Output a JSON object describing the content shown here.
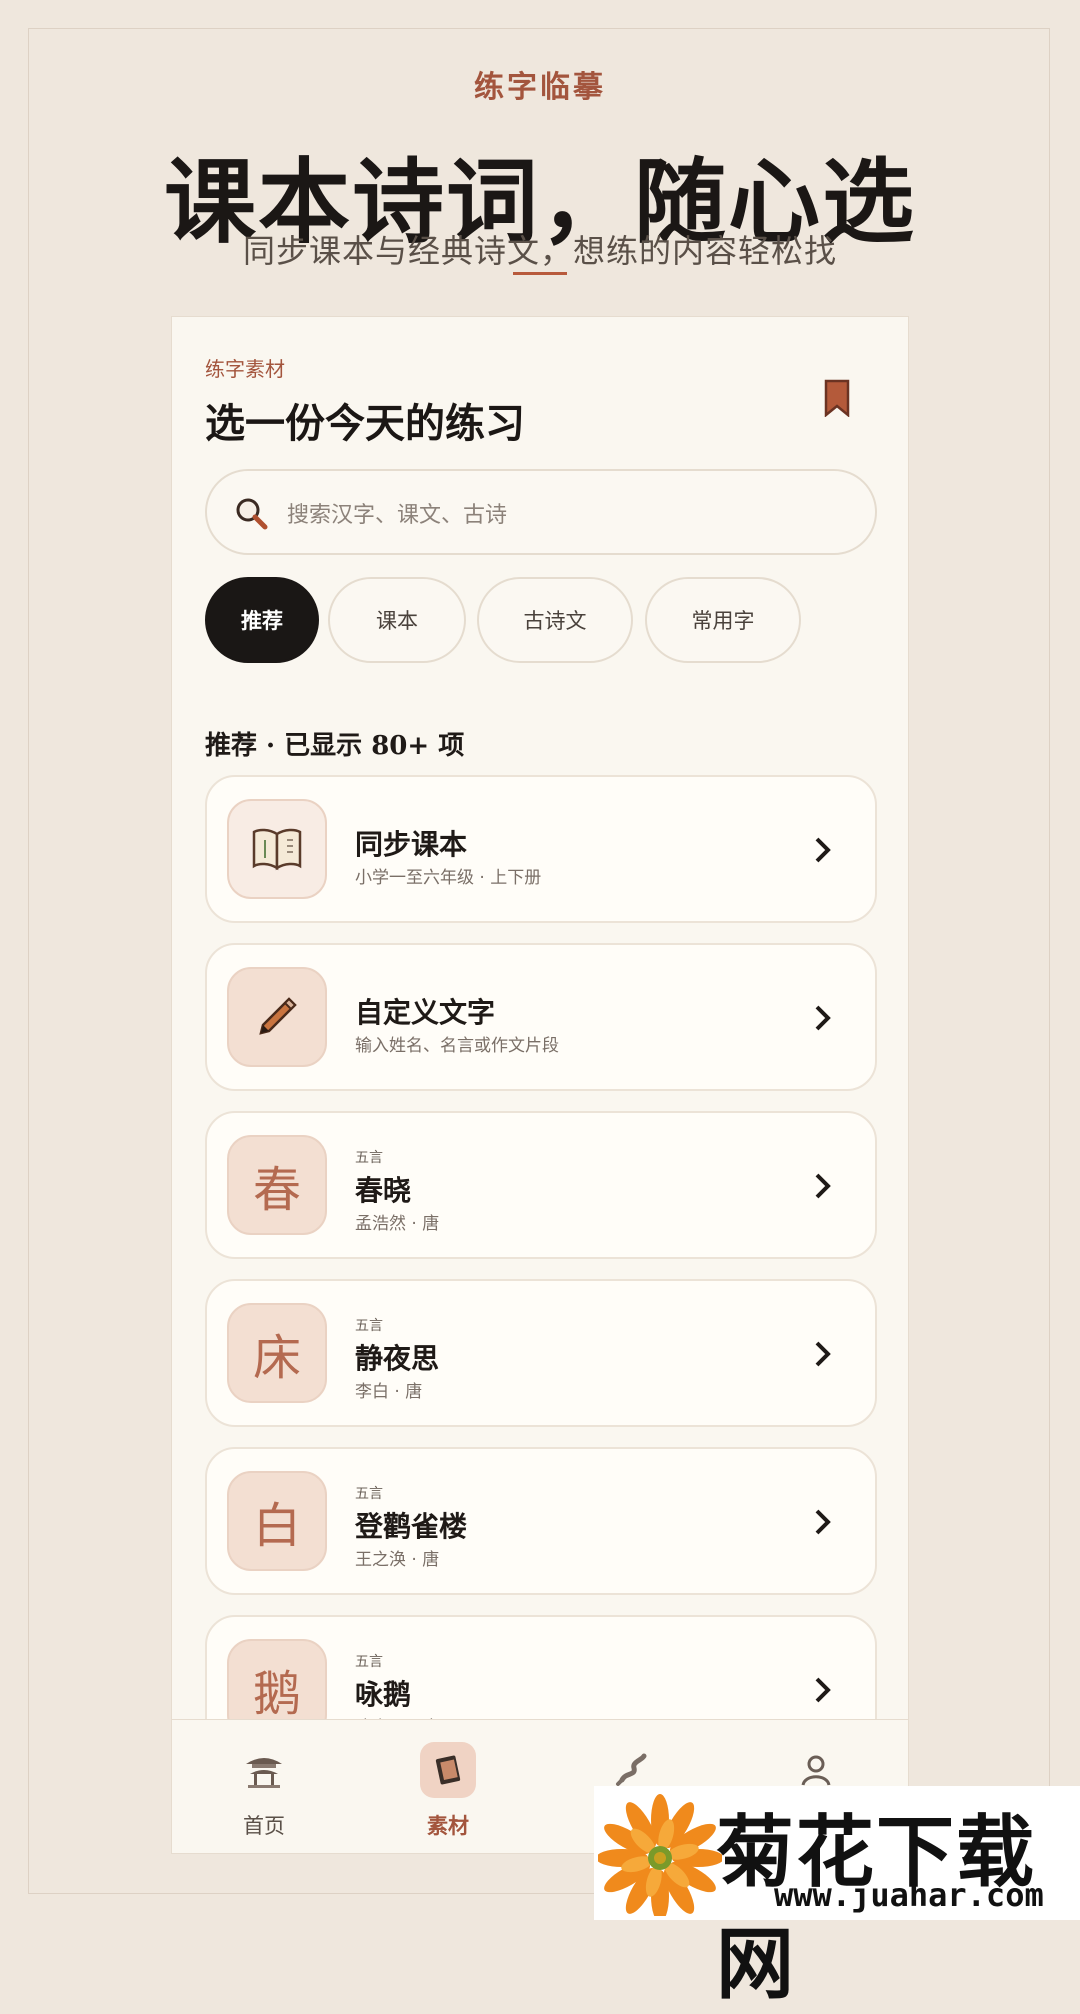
{
  "header": {
    "brand": "练字临摹",
    "headline": "课本诗词，随心选",
    "subline": "同步课本与经典诗文，想练的内容轻松找"
  },
  "screen": {
    "overline": "练字素材",
    "title": "选一份今天的练习",
    "bookmark_icon": "bookmark-icon",
    "search": {
      "placeholder": "搜索汉字、课文、古诗"
    },
    "chips": [
      {
        "label": "推荐",
        "active": true
      },
      {
        "label": "课本",
        "active": false
      },
      {
        "label": "古诗文",
        "active": false
      },
      {
        "label": "常用字",
        "active": false
      }
    ],
    "section_label": "推荐 · 已显示 80+ 项",
    "items": [
      {
        "icon": "book-icon",
        "title": "同步课本",
        "subtitle": "小学一至六年级 · 上下册"
      },
      {
        "icon": "pencil-icon",
        "title": "自定义文字",
        "subtitle": "输入姓名、名言或作文片段"
      },
      {
        "char": "春",
        "tag": "五言",
        "title": "春晓",
        "subtitle": "孟浩然 · 唐"
      },
      {
        "char": "床",
        "tag": "五言",
        "title": "静夜思",
        "subtitle": "李白 · 唐"
      },
      {
        "char": "白",
        "tag": "五言",
        "title": "登鹳雀楼",
        "subtitle": "王之涣 · 唐"
      },
      {
        "char": "鹅",
        "tag": "五言",
        "title": "咏鹅",
        "subtitle": "骆宾王 · 唐"
      }
    ],
    "tabs": [
      {
        "label": "首页",
        "icon": "pavilion-icon",
        "active": false
      },
      {
        "label": "素材",
        "icon": "book-icon",
        "active": true
      },
      {
        "label": "",
        "icon": "brush-icon",
        "active": false
      },
      {
        "label": "",
        "icon": "user-icon",
        "active": false
      }
    ]
  },
  "watermark": {
    "title": "菊花下载网",
    "url": "www.juahar.com"
  },
  "colors": {
    "accent": "#a3553d",
    "background": "#efe7dd",
    "chip_active": "#1a1715",
    "thumb": "#f3dfd2"
  }
}
